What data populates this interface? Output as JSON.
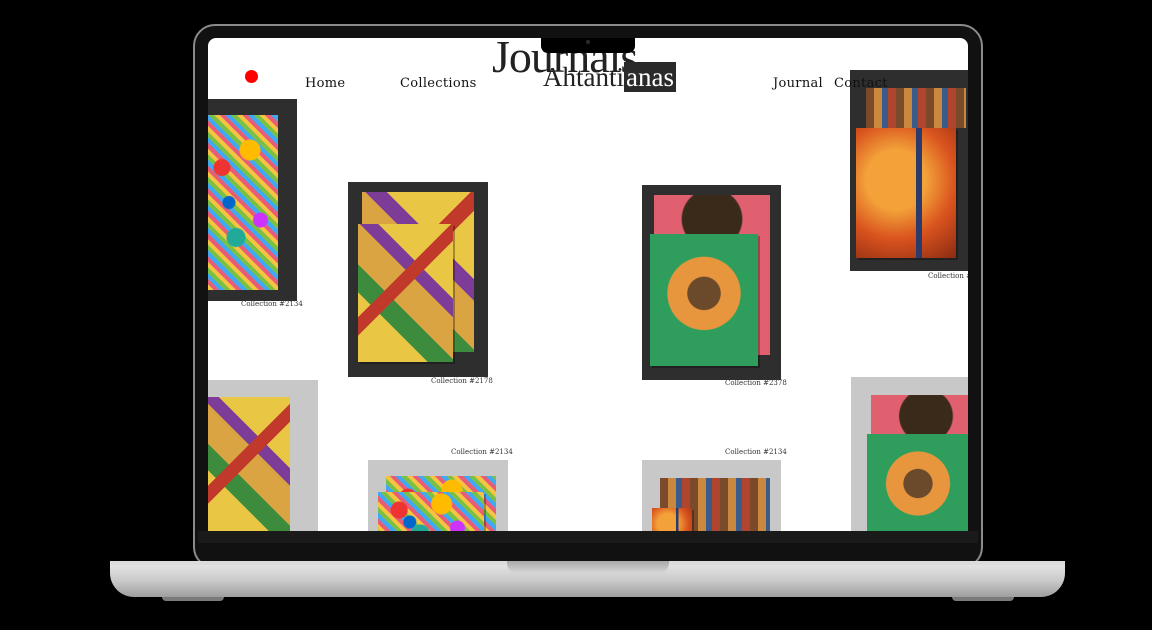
{
  "site": {
    "logo_top": "Journals",
    "logo_bottom_left": "Ahtanti",
    "logo_bottom_right": "anas"
  },
  "nav": {
    "home": "Home",
    "collections": "Collections",
    "journal": "Journal",
    "contact": "Contact"
  },
  "gallery": {
    "captions": [
      "Collection #2134",
      "Collection #2178",
      "Collection #2378",
      "Collection #",
      "Collection #2134",
      "Collection #2134"
    ]
  },
  "colors": {
    "accent_dot": "#ff0000",
    "frame_dark": "#2e2e2e",
    "frame_light": "#c8c8c8"
  }
}
